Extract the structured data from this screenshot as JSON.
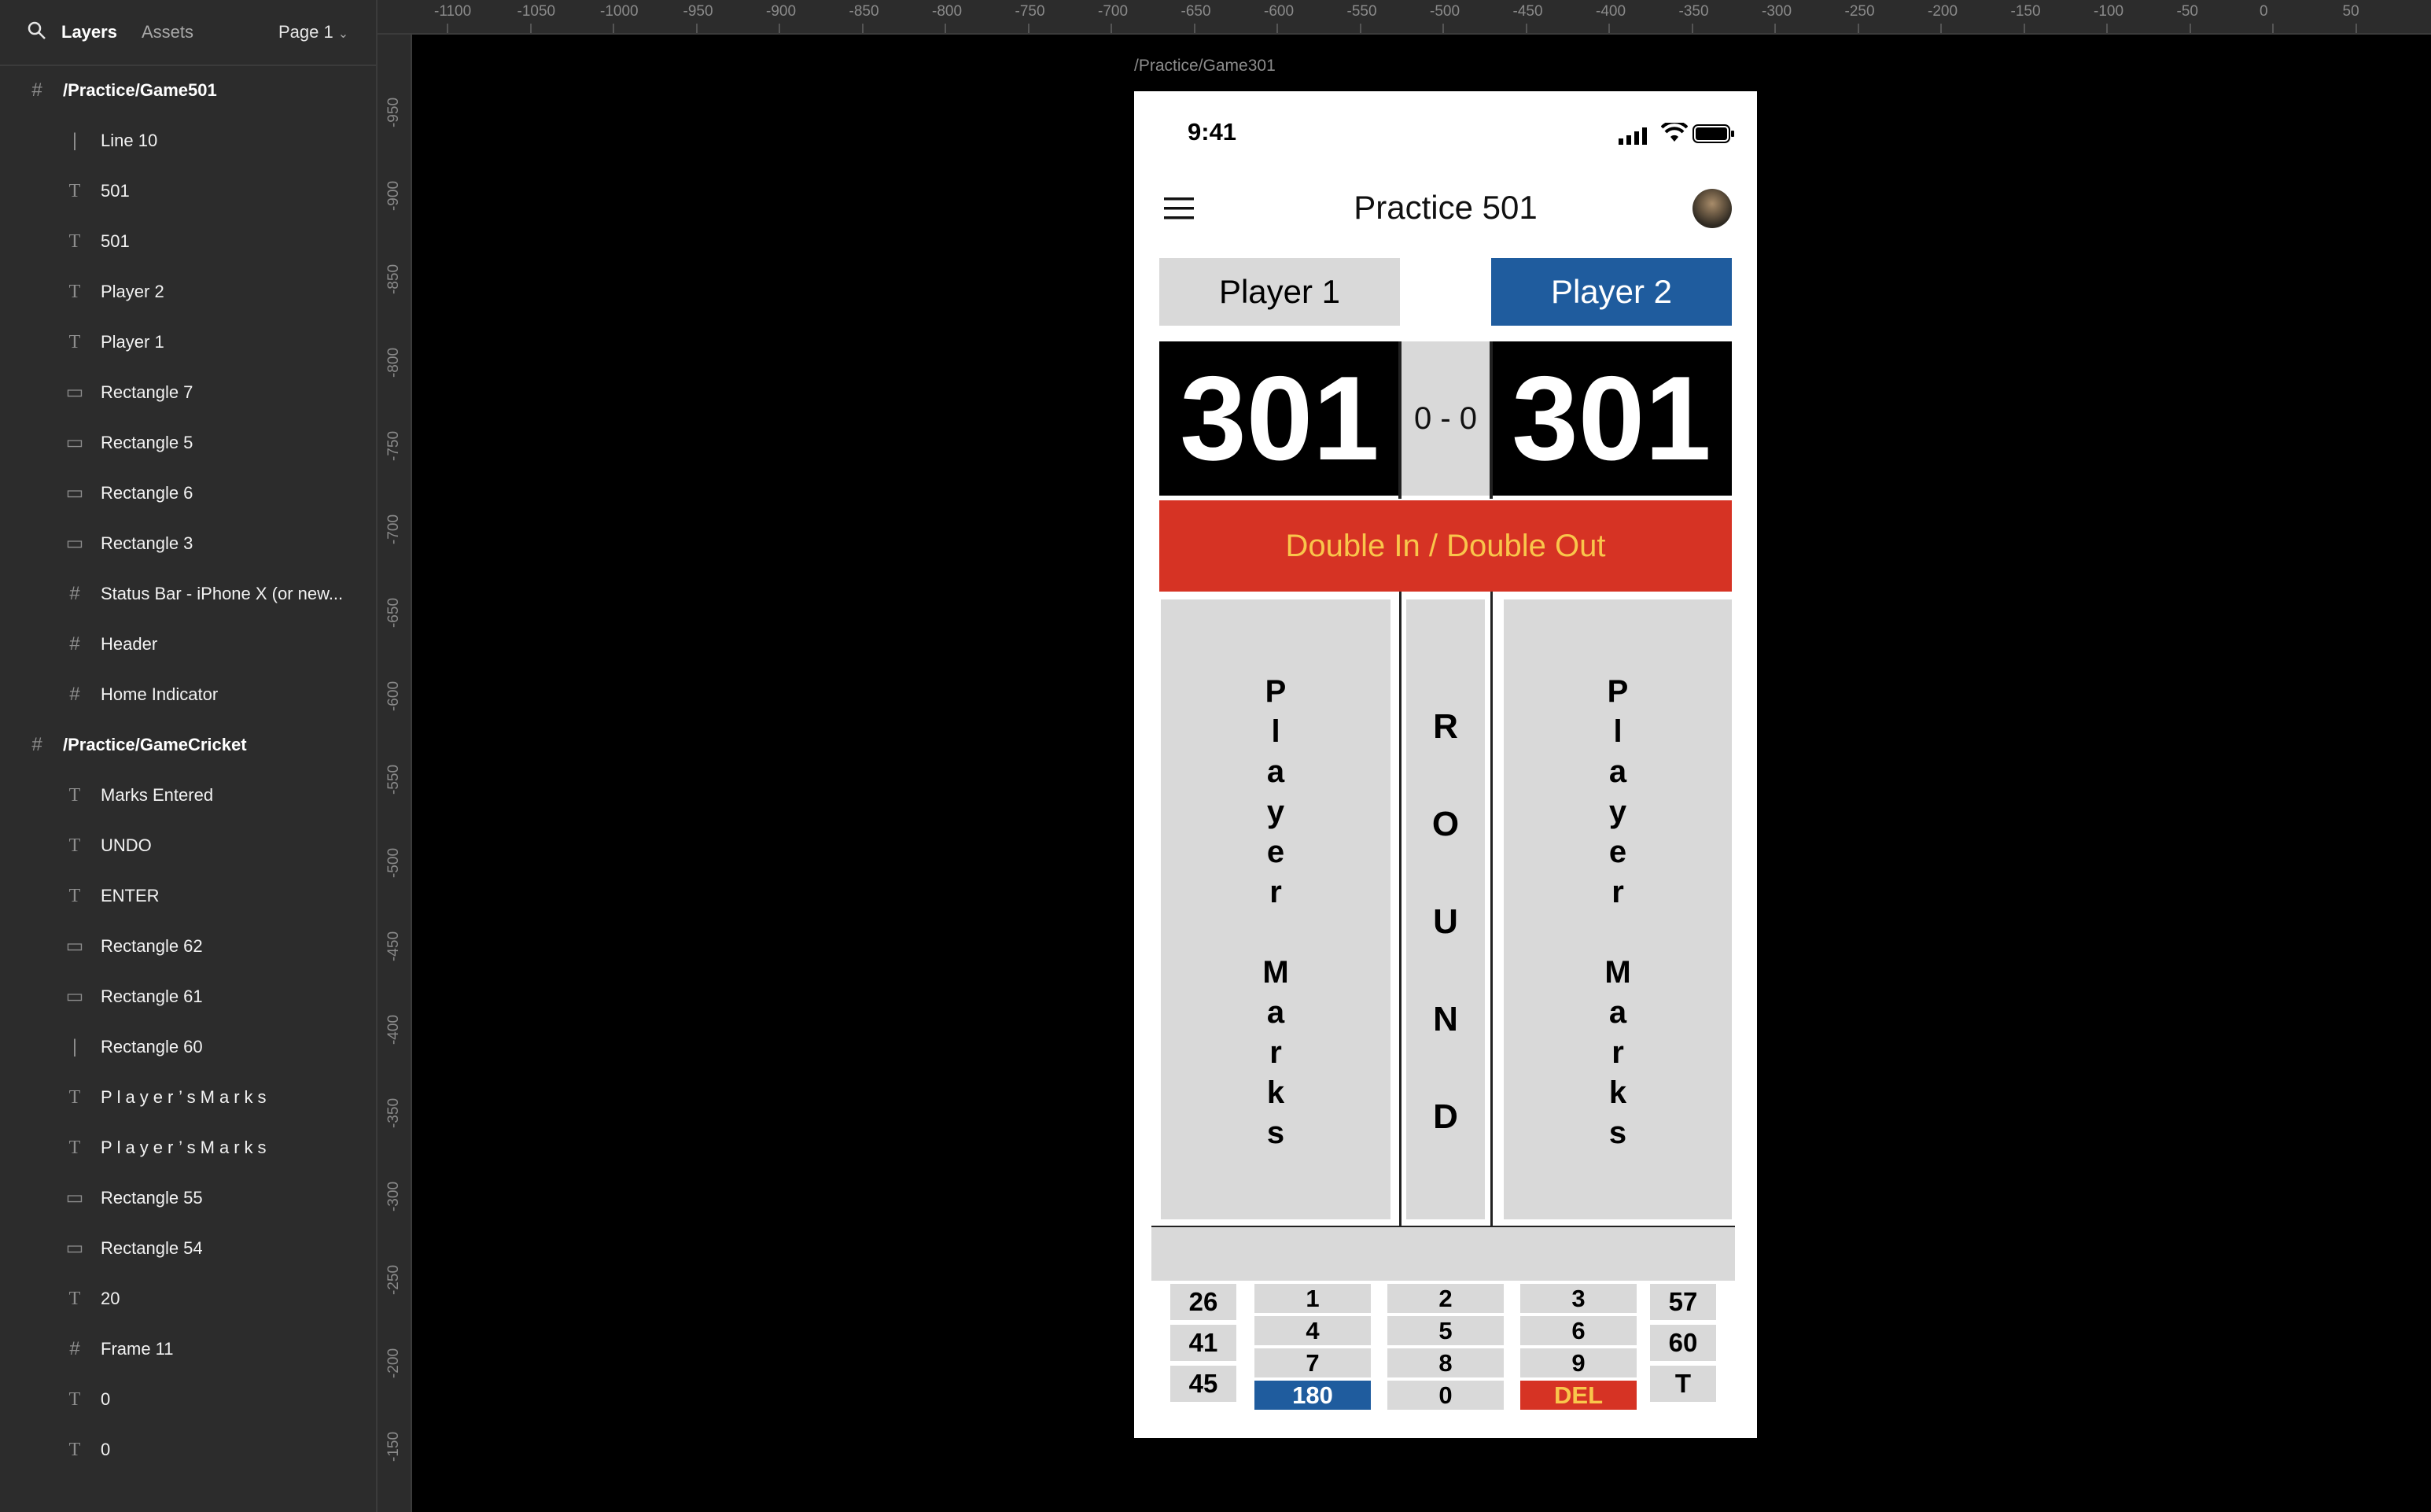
{
  "sidebar": {
    "tabs": {
      "layers": "Layers",
      "assets": "Assets"
    },
    "page_selector": "Page 1",
    "layers": [
      {
        "label": "/Practice/Game501",
        "icon": "frame-icon",
        "kind": "frame"
      },
      {
        "label": "Line 10",
        "icon": "line-icon",
        "kind": "child"
      },
      {
        "label": "501",
        "icon": "text-icon",
        "kind": "child"
      },
      {
        "label": "501",
        "icon": "text-icon",
        "kind": "child"
      },
      {
        "label": "Player 2",
        "icon": "text-icon",
        "kind": "child"
      },
      {
        "label": "Player 1",
        "icon": "text-icon",
        "kind": "child"
      },
      {
        "label": "Rectangle 7",
        "icon": "rectangle-icon",
        "kind": "child"
      },
      {
        "label": "Rectangle 5",
        "icon": "rectangle-icon",
        "kind": "child"
      },
      {
        "label": "Rectangle 6",
        "icon": "rectangle-icon",
        "kind": "child"
      },
      {
        "label": "Rectangle 3",
        "icon": "rectangle-icon",
        "kind": "child"
      },
      {
        "label": "Status Bar - iPhone X (or new...",
        "icon": "frame-icon",
        "kind": "child"
      },
      {
        "label": "Header",
        "icon": "frame-icon",
        "kind": "child"
      },
      {
        "label": "Home Indicator",
        "icon": "frame-icon",
        "kind": "child"
      },
      {
        "label": "/Practice/GameCricket",
        "icon": "frame-icon",
        "kind": "frame"
      },
      {
        "label": "Marks Entered",
        "icon": "text-icon",
        "kind": "child"
      },
      {
        "label": "UNDO",
        "icon": "text-icon",
        "kind": "child"
      },
      {
        "label": "ENTER",
        "icon": "text-icon",
        "kind": "child"
      },
      {
        "label": "Rectangle 62",
        "icon": "rectangle-icon",
        "kind": "child"
      },
      {
        "label": "Rectangle 61",
        "icon": "rectangle-icon",
        "kind": "child"
      },
      {
        "label": "Rectangle 60",
        "icon": "line-icon",
        "kind": "child"
      },
      {
        "label": "Player’sMarks",
        "icon": "text-icon",
        "kind": "child",
        "spaced": true
      },
      {
        "label": "Player’sMarks",
        "icon": "text-icon",
        "kind": "child",
        "spaced": true
      },
      {
        "label": "Rectangle 55",
        "icon": "rectangle-icon",
        "kind": "child"
      },
      {
        "label": "Rectangle 54",
        "icon": "rectangle-icon",
        "kind": "child"
      },
      {
        "label": "20",
        "icon": "text-icon",
        "kind": "child"
      },
      {
        "label": "Frame 11",
        "icon": "frame-icon",
        "kind": "child"
      },
      {
        "label": "0",
        "icon": "text-icon",
        "kind": "child"
      },
      {
        "label": "0",
        "icon": "text-icon",
        "kind": "child"
      }
    ]
  },
  "ruler": {
    "top": [
      "-1100",
      "-1050",
      "-1000",
      "-950",
      "-900",
      "-850",
      "-800",
      "-750",
      "-700",
      "-650",
      "-600",
      "-550",
      "-500",
      "-450",
      "-400",
      "-350",
      "-300",
      "-250",
      "-200",
      "-150",
      "-100",
      "-50",
      "0",
      "50"
    ],
    "left": [
      "-950",
      "-900",
      "-850",
      "-800",
      "-750",
      "-700",
      "-650",
      "-600",
      "-550",
      "-500",
      "-450",
      "-400",
      "-350",
      "-300",
      "-250",
      "-200",
      "-150"
    ]
  },
  "canvas": {
    "frame_label": "/Practice/Game301",
    "phone": {
      "status_time": "9:41",
      "title": "Practice 501",
      "player1": "Player 1",
      "player2": "Player 2",
      "score1": "301",
      "score2": "301",
      "legs": "0 - 0",
      "mode": "Double In / Double Out",
      "left_panel": [
        "P",
        "l",
        "a",
        "y",
        "e",
        "r",
        "",
        "M",
        "a",
        "r",
        "k",
        "s"
      ],
      "round_panel": [
        "R",
        "O",
        "U",
        "N",
        "D"
      ],
      "right_panel": [
        "P",
        "l",
        "a",
        "y",
        "e",
        "r",
        "",
        "M",
        "a",
        "r",
        "k",
        "s"
      ],
      "keypad": {
        "left_col": [
          "26",
          "41",
          "45"
        ],
        "num1": [
          "1",
          "4",
          "7",
          "180"
        ],
        "num2": [
          "2",
          "5",
          "8",
          "0"
        ],
        "num3": [
          "3",
          "6",
          "9",
          "DEL"
        ],
        "right_col": [
          "57",
          "60",
          "T"
        ]
      },
      "colors": {
        "blue": "#1f5c9e",
        "red": "#d63324",
        "yellow": "#f9c64b",
        "panel": "#d9d9d9"
      }
    }
  }
}
